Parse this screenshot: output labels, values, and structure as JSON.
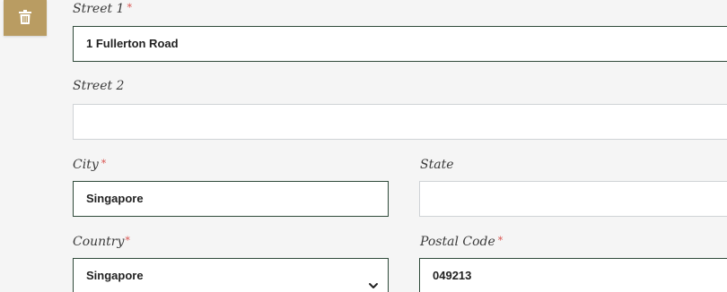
{
  "delete_button": {
    "icon": "trash-icon",
    "color": "#b99c62"
  },
  "street1": {
    "label": "Street 1",
    "required_mark": "*",
    "value": "1 Fullerton Road"
  },
  "street2": {
    "label": "Street 2",
    "value": ""
  },
  "city": {
    "label": "City",
    "required_mark": "*",
    "value": "Singapore"
  },
  "state": {
    "label": "State",
    "value": ""
  },
  "country": {
    "label": "Country",
    "required_mark": "*",
    "value": "Singapore",
    "icon": "chevron-down-icon"
  },
  "postal_code": {
    "label": "Postal Code",
    "required_mark": "*",
    "value": "049213"
  },
  "colors": {
    "required": "#d9534f",
    "active_border": "#2f4a3a",
    "page_bg": "#f5f5f5"
  }
}
